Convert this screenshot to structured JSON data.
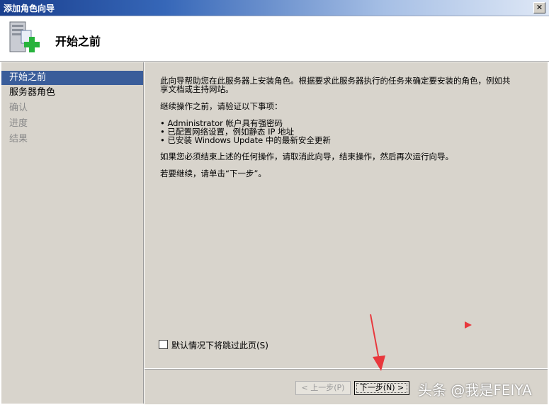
{
  "window": {
    "title": "添加角色向导",
    "close_glyph": "✕"
  },
  "header": {
    "title": "开始之前",
    "icon": "server-add-icon"
  },
  "steps": [
    {
      "label": "开始之前",
      "state": "active"
    },
    {
      "label": "服务器角色",
      "state": "normal"
    },
    {
      "label": "确认",
      "state": "disabled"
    },
    {
      "label": "进度",
      "state": "disabled"
    },
    {
      "label": "结果",
      "state": "disabled"
    }
  ],
  "content": {
    "intro_line1": "此向导帮助您在此服务器上安装角色。根据要求此服务器执行的任务来确定要安装的角色，例如共",
    "intro_line2": "享文档或主持网站。",
    "verify_heading": "继续操作之前，请验证以下事项：",
    "bullets": [
      "• Administrator 帐户具有强密码",
      "• 已配置网络设置，例如静态 IP 地址",
      "• 已安装 Windows Update 中的最新安全更新"
    ],
    "cancel_note": "如果您必须结束上述的任何操作，请取消此向导，结束操作，然后再次运行向导。",
    "continue_note": "若要继续，请单击“下一步”。"
  },
  "skip_checkbox": {
    "label": "默认情况下将跳过此页(S)",
    "checked": false
  },
  "buttons": {
    "prev": "< 上一步(P)",
    "next": "下一步(N) >"
  },
  "watermark": "头条 @我是FEIYA",
  "colors": {
    "accent": "#3a5d9a",
    "title_start": "#1a3f8e",
    "panel": "#d8d4cc",
    "annotation": "#e8383d"
  }
}
